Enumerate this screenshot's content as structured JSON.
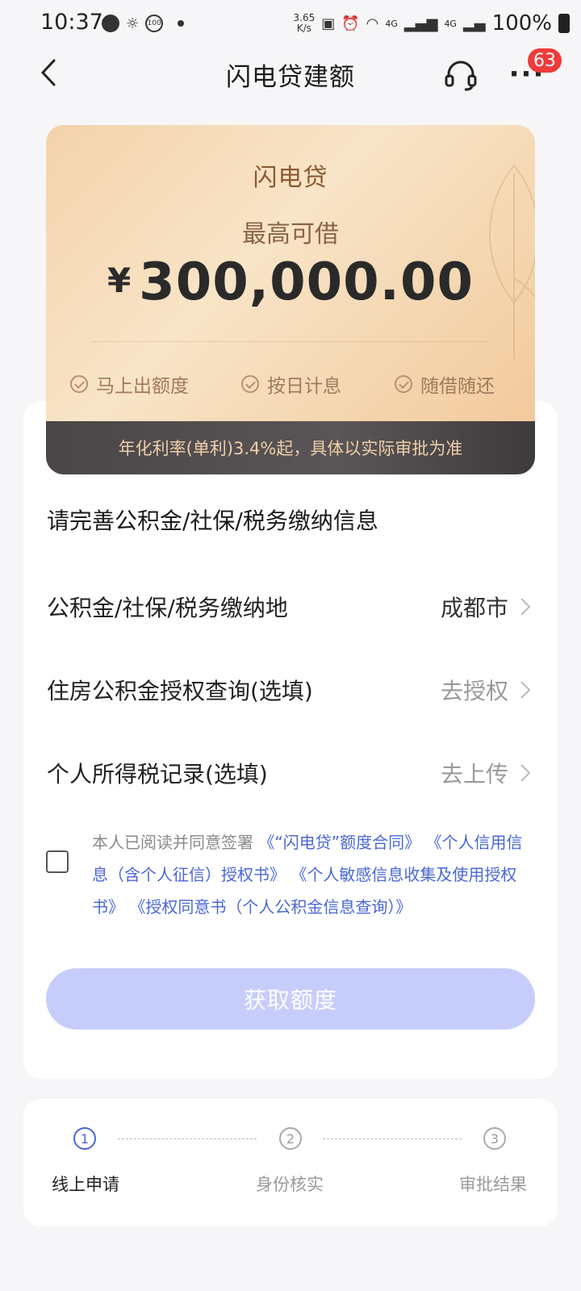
{
  "status_bar": {
    "time": "10:37",
    "speed_value": "3.65",
    "speed_unit": "K/s",
    "net1": "4G",
    "net2": "4G",
    "battery": "100%",
    "circle_icon_text": "100"
  },
  "nav": {
    "title": "闪电贷建额",
    "badge_count": "63",
    "more_label": "···"
  },
  "loan_card": {
    "product_name": "闪电贷",
    "subtitle": "最高可借",
    "currency": "¥",
    "amount": "300,000.00",
    "features": [
      "马上出额度",
      "按日计息",
      "随借随还"
    ],
    "rate_note": "年化利率(单利)3.4%起，具体以实际审批为准"
  },
  "form": {
    "heading": "请完善公积金/社保/税务缴纳信息",
    "rows": [
      {
        "label": "公积金/社保/税务缴纳地",
        "value": "成都市"
      },
      {
        "label": "住房公积金授权查询(选填)",
        "value": "去授权"
      },
      {
        "label": "个人所得税记录(选填)",
        "value": "去上传"
      }
    ]
  },
  "agreement": {
    "prefix": "本人已阅读并同意签署",
    "links": [
      "《“闪电贷”额度合同》",
      "《个人信用信息（含个人征信）授权书》",
      "《个人敏感信息收集及使用授权书》",
      "《授权同意书（个人公积金信息查询）》"
    ]
  },
  "cta": {
    "label": "获取额度"
  },
  "steps": [
    {
      "num": "1",
      "label": "线上申请"
    },
    {
      "num": "2",
      "label": "身份核实"
    },
    {
      "num": "3",
      "label": "审批结果"
    }
  ],
  "colors": {
    "accent": "#4a67d6",
    "cta_disabled": "#c7cdfb",
    "badge": "#f03b3b",
    "gold_text": "#8a5a35"
  }
}
